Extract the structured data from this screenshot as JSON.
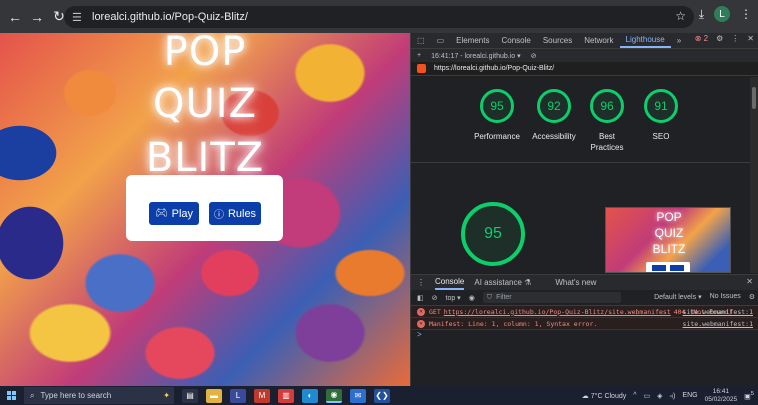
{
  "browser": {
    "url": "lorealci.github.io/Pop-Quiz-Blitz/",
    "avatar_letter": "L"
  },
  "page": {
    "title_words": [
      "POP",
      "QUIZ",
      "BLITZ"
    ],
    "play_label": "Play",
    "rules_label": "Rules"
  },
  "devtools": {
    "tabs": [
      "Elements",
      "Console",
      "Sources",
      "Network",
      "Lighthouse"
    ],
    "active_tab": "Lighthouse",
    "error_count": "2",
    "report_time": "16:41:17 - lorealci.github.io",
    "report_url": "https://lorealci.github.io/Pop-Quiz-Blitz/",
    "scores": [
      {
        "label": "Performance",
        "value": "95"
      },
      {
        "label": "Accessibility",
        "value": "92"
      },
      {
        "label": "Best Practices",
        "value": "96"
      },
      {
        "label": "SEO",
        "value": "91"
      }
    ],
    "big_score": "95",
    "thumb_words": [
      "POP",
      "QUIZ",
      "BLITZ"
    ]
  },
  "console": {
    "tabs": [
      "Console",
      "AI assistance",
      "What's new"
    ],
    "context": "top",
    "filter_placeholder": "Filter",
    "levels": "Default levels",
    "issues": "No Issues",
    "logs": [
      {
        "method": "GET",
        "link": "https://lorealci.github.io/Pop-Quiz-Blitz/site.webmanifest",
        "status": "404 (Not Found)",
        "source": "site.webmanifest:1"
      },
      {
        "text": "Manifest: Line: 1, column: 1, Syntax error.",
        "source": "site.webmanifest:1"
      }
    ],
    "prompt": ">"
  },
  "taskbar": {
    "search_placeholder": "Type here to search",
    "weather": "7°C  Cloudy",
    "lang": "ENG",
    "time": "16:41",
    "date": "05/02/2025",
    "notif_count": "5"
  },
  "colors": {
    "accent_button": "#0b3ea8",
    "score_green": "#0cce6b",
    "error_red": "#f28b82"
  }
}
